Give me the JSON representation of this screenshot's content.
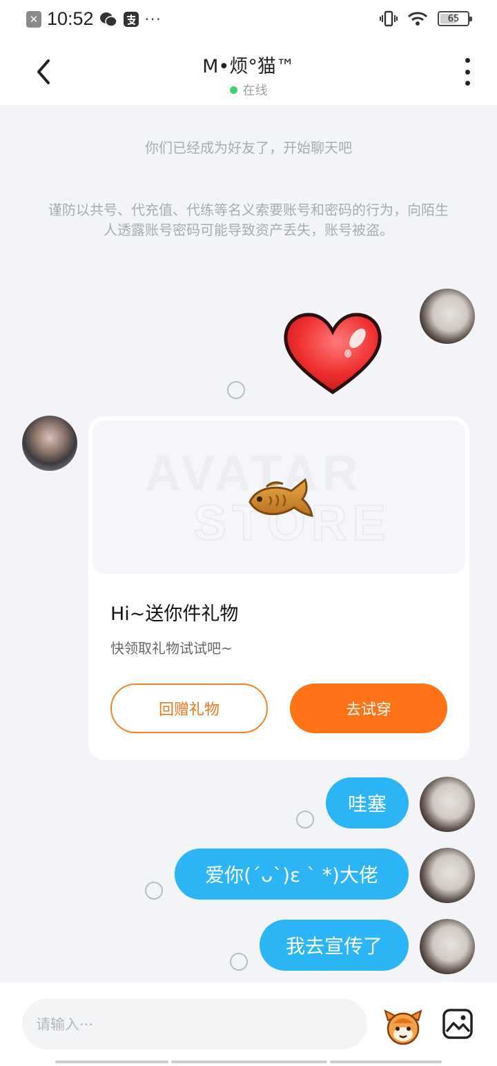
{
  "status_bar": {
    "time": "10:52",
    "icons": [
      "close-x-icon",
      "wechat-icon",
      "alipay-icon",
      "more-dots-icon",
      "vibrate-icon",
      "wifi-icon",
      "battery-icon"
    ],
    "dots": "···",
    "battery_level": "65"
  },
  "header": {
    "title": "M•烦°猫™",
    "status": "在线",
    "status_color": "#3bd16f"
  },
  "system": {
    "friend_notice": "你们已经成为好友了，开始聊天吧",
    "security_notice": "谨防以共号、代充值、代练等名义索要账号和密码的行为，向陌生人透露账号密码可能导致资产丢失，账号被盗。"
  },
  "gift_card": {
    "title": "Hi~送你件礼物",
    "subtitle": "快领取礼物试试吧~",
    "watermark_line1": "AVATAR",
    "watermark_line2": "STORE",
    "return_gift_label": "回赠礼物",
    "try_on_label": "去试穿"
  },
  "messages": [
    {
      "from": "me",
      "type": "sticker",
      "content": "heart-sticker"
    },
    {
      "from": "me",
      "type": "text",
      "content": "哇塞"
    },
    {
      "from": "me",
      "type": "text",
      "content": "爱你(ˊᴗˋ)ε ` *)大佬"
    },
    {
      "from": "me",
      "type": "text",
      "content": "我去宣传了"
    }
  ],
  "input": {
    "placeholder": "请输入···"
  },
  "colors": {
    "accent_orange": "#ff7216",
    "bubble_blue": "#2bb4f6",
    "background": "#f2f4f7"
  }
}
